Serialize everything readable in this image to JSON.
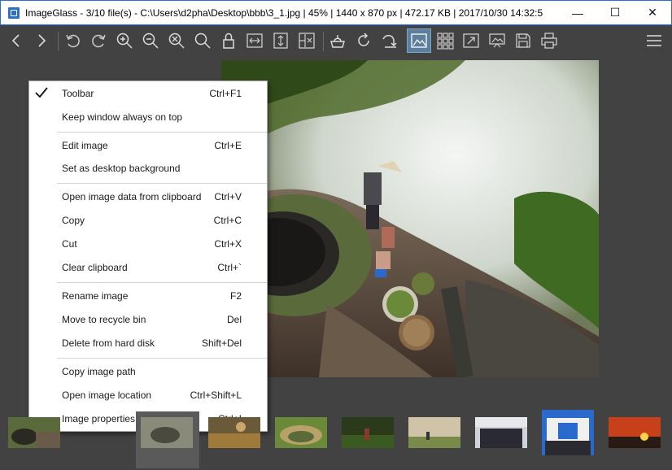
{
  "window": {
    "title": "ImageGlass - 3/10 file(s) - C:\\Users\\d2pha\\Desktop\\bbb\\3_1.jpg | 45% | 1440 x 870 px | 472.17 KB | 2017/10/30 14:32:5",
    "minimize_glyph": "—",
    "maximize_glyph": "☐",
    "close_glyph": "✕"
  },
  "toolbar": {
    "buttons": [
      "previous-image-icon",
      "next-image-icon",
      "rotate-left-icon",
      "rotate-right-icon",
      "zoom-in-icon",
      "zoom-out-icon",
      "scale-to-fit-icon",
      "actual-size-icon",
      "lock-zoom-icon",
      "scale-to-width-icon",
      "scale-to-height-icon",
      "auto-zoom-icon",
      "open-file-icon",
      "refresh-icon",
      "goto-image-icon",
      "checkerboard-icon",
      "thumbnail-bar-icon",
      "full-screen-icon",
      "slideshow-icon",
      "save-icon",
      "print-icon",
      "main-menu-icon"
    ],
    "active_button": "checkerboard-icon"
  },
  "context_menu": {
    "items": [
      {
        "label": "Toolbar",
        "shortcut": "Ctrl+F1",
        "checked": true
      },
      {
        "label": "Keep window always on top",
        "shortcut": ""
      },
      {
        "label": "Edit image",
        "shortcut": "Ctrl+E"
      },
      {
        "label": "Set as desktop background",
        "shortcut": ""
      },
      {
        "label": "Open image data from clipboard",
        "shortcut": "Ctrl+V"
      },
      {
        "label": "Copy",
        "shortcut": "Ctrl+C"
      },
      {
        "label": "Cut",
        "shortcut": "Ctrl+X"
      },
      {
        "label": "Clear clipboard",
        "shortcut": "Ctrl+`"
      },
      {
        "label": "Rename image",
        "shortcut": "F2"
      },
      {
        "label": "Move to recycle bin",
        "shortcut": "Del"
      },
      {
        "label": "Delete from hard disk",
        "shortcut": "Shift+Del"
      },
      {
        "label": "Copy image path",
        "shortcut": ""
      },
      {
        "label": "Open image location",
        "shortcut": "Ctrl+Shift+L"
      },
      {
        "label": "Image properties",
        "shortcut": "Ctrl+I"
      }
    ]
  },
  "thumbnails": {
    "count": 10,
    "selected_index": 2
  },
  "colors": {
    "background": "#424242",
    "accent": "#2a6fd6",
    "active_tool": "#5b7f9d"
  }
}
